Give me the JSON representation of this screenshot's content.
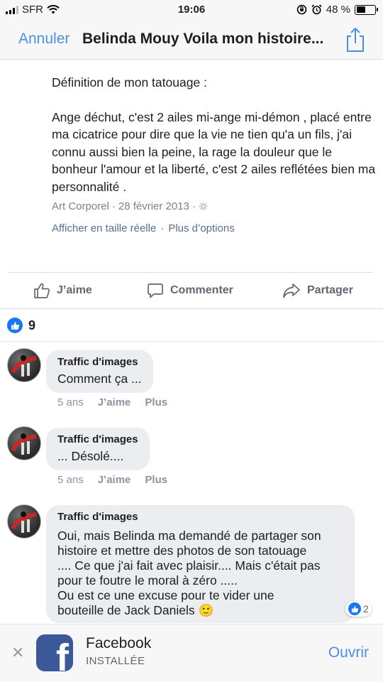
{
  "status_bar": {
    "carrier": "SFR",
    "time": "19:06",
    "battery": "48 %",
    "battery_level": 0.48
  },
  "nav": {
    "cancel_label": "Annuler",
    "title": "Belinda Mouy Voila mon histoire..."
  },
  "post": {
    "paragraph1": "Définition de mon tatouage :",
    "paragraph2": "Ange déchut, c'est 2 ailes mi-ange mi-démon , placé entre ma cicatrice pour dire que la vie ne tien qu'a un fils, j'ai connu aussi bien la peine, la rage la douleur que le bonheur l'amour et la liberté, c'est 2 ailes reflétées bien ma personnalité .",
    "album": "Art Corporel",
    "separator": "·",
    "date": "28 février 2013",
    "link_full_size": "Afficher en taille réelle",
    "link_more_options": "Plus d’options"
  },
  "actions": {
    "like": "J’aime",
    "comment": "Commenter",
    "share": "Partager"
  },
  "likes_count": "9",
  "comments": [
    {
      "author": "Traffic d'images",
      "text": "Comment ça ...",
      "time": "5 ans",
      "like_label": "J’aime",
      "more_label": "Plus"
    },
    {
      "author": "Traffic d'images",
      "text": "... Désolé....",
      "time": "5 ans",
      "like_label": "J’aime",
      "more_label": "Plus"
    },
    {
      "author": "Traffic d'images",
      "text_lines": [
        "Oui, mais Belinda ma demandé de partager son",
        "histoire et mettre des photos de son tatouage",
        ".... Ce que j'ai fait avec plaisir.... Mais c'était pas",
        "pour te foutre le moral à zéro .....",
        "Ou est ce une excuse pour te vider une",
        "bouteille de Jack Daniels"
      ],
      "emoji": "🙂",
      "reactions": "2"
    }
  ],
  "banner": {
    "app_name": "Facebook",
    "status": "INSTALLÉE",
    "open_label": "Ouvrir"
  },
  "colors": {
    "link_blue": "#4a90e2",
    "facebook_blue": "#1877f2",
    "facebook_logo": "#3b5998"
  }
}
